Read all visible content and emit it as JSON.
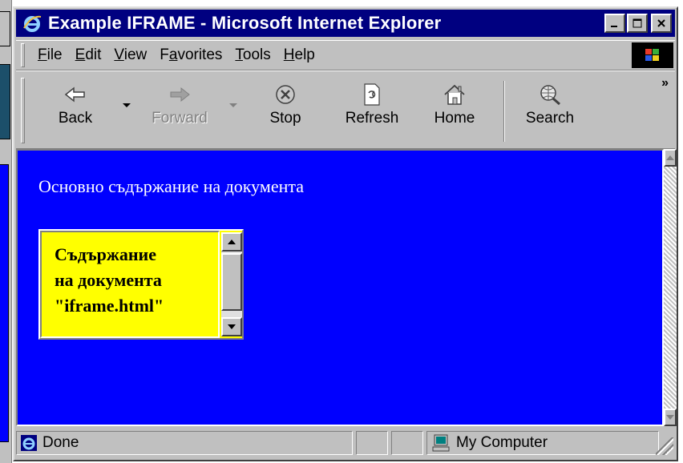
{
  "window": {
    "title": "Example IFRAME - Microsoft Internet Explorer",
    "controls": {
      "minimize": "_",
      "maximize": "□",
      "close": "✕"
    }
  },
  "menubar": {
    "items": [
      {
        "label": "File",
        "accel": "F",
        "rest": "ile"
      },
      {
        "label": "Edit",
        "accel": "E",
        "rest": "dit"
      },
      {
        "label": "View",
        "accel": "V",
        "rest": "iew"
      },
      {
        "label": "Favorites",
        "pre": "F",
        "accel": "a",
        "rest": "vorites"
      },
      {
        "label": "Tools",
        "accel": "T",
        "rest": "ools"
      },
      {
        "label": "Help",
        "accel": "H",
        "rest": "elp"
      }
    ]
  },
  "toolbar": {
    "back": "Back",
    "forward": "Forward",
    "stop": "Stop",
    "refresh": "Refresh",
    "home": "Home",
    "search": "Search",
    "more": "»"
  },
  "content": {
    "main_text": "Основно съдържание на документа",
    "background_color": "#0000ff",
    "text_color": "#ffffff"
  },
  "iframe": {
    "lines": [
      "Съдържание",
      "на документа",
      "\"iframe.html\""
    ],
    "background_color": "#ffff00"
  },
  "statusbar": {
    "status": "Done",
    "zone": "My Computer"
  },
  "colors": {
    "titlebar": "#000080",
    "chrome": "#c0c0c0"
  }
}
